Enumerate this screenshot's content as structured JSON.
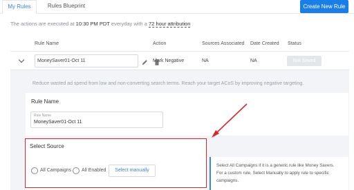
{
  "tabs": [
    {
      "label": "My Rules",
      "active": true
    },
    {
      "label": "Rules Blueprint",
      "active": false
    }
  ],
  "create_button": "Create New Rule",
  "exec": {
    "prefix": "The actions are executed at",
    "time": "10:30 PM PDT",
    "middle": "everyday with a",
    "attribution": "72 hour attribution"
  },
  "table": {
    "headers": [
      "Rule Name",
      "Action",
      "Sources Associated",
      "Date Created",
      "Status"
    ],
    "row": {
      "name": "MoneySaver01-Oct 11",
      "action": "Mark Negative",
      "sources": "NA",
      "date_created": "NA",
      "status": "Not Saved"
    }
  },
  "description": "Reduce wasted ad spend from low and non-converting search terms. Reach your target ACoS by improving negative targeting.",
  "rule_name_card": {
    "title": "Rule Name",
    "field_label": "Rule Name",
    "field_value": "MoneySaver01-Oct 11"
  },
  "select_source": {
    "title": "Select Source",
    "options": [
      "All Campaigns",
      "All Enabled"
    ],
    "manual_button": "Select manually"
  },
  "help_text": [
    "Select All Campaigns if it is a generic rule like Money Savers.",
    "For a custom rule, Select Manually to apply rule to specific",
    "campaigns."
  ],
  "colors": {
    "accent": "#1a7ee8",
    "link": "#3a86d6",
    "highlight": "#d9262c"
  }
}
